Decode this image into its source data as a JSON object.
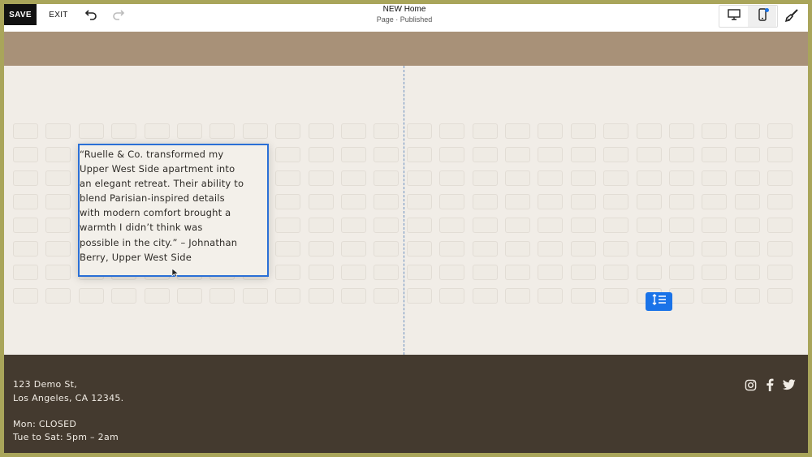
{
  "toolbar": {
    "save_label": "SAVE",
    "exit_label": "EXIT",
    "page_title": "NEW Home",
    "page_subtitle": "Page · Published"
  },
  "icons": {
    "undo": "undo-icon",
    "redo": "redo-icon",
    "desktop": "desktop-icon",
    "mobile": "mobile-icon",
    "design": "paintbrush-icon",
    "spacing": "spacing-icon",
    "social": [
      "instagram-icon",
      "facebook-icon",
      "twitter-icon"
    ]
  },
  "colors": {
    "accent": "#1a73e8",
    "header_band": "#a89178",
    "section_bg": "#f1ede7",
    "footer_bg": "#443a2f",
    "frame": "#a9a55a"
  },
  "testimonial": {
    "lines": [
      "“Ruelle & Co. transformed my",
      "Upper West Side apartment into",
      "an elegant retreat. Their ability to",
      "blend Parisian-inspired details",
      "with modern comfort brought a",
      "warmth I didn’t think was",
      "possible in the city.” – Johnathan",
      "Berry, Upper West Side"
    ]
  },
  "footer": {
    "address_line1": "123 Demo St,",
    "address_line2": "Los Angeles, CA 12345.",
    "hours_line1": "Mon: CLOSED",
    "hours_line2": "Tue to Sat: 5pm – 2am"
  }
}
